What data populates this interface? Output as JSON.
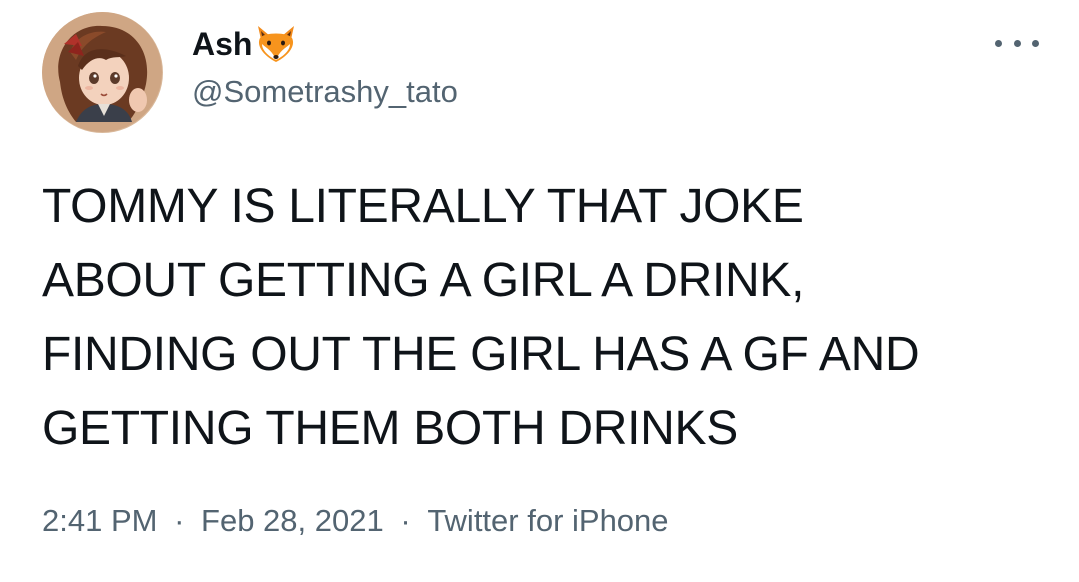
{
  "user": {
    "display_name": "Ash",
    "handle": "@Sometrashy_tato",
    "name_emoji": "fox-icon",
    "avatar": "avatar-illustration"
  },
  "tweet": {
    "lines": [
      "TOMMY IS LITERALLY THAT JOKE",
      "ABOUT GETTING A GIRL A DRINK,",
      "FINDING OUT THE GIRL HAS A GF AND",
      "GETTING THEM BOTH DRINKS"
    ],
    "time": "2:41 PM",
    "separator": "·",
    "date": "Feb 28, 2021",
    "source": "Twitter for iPhone"
  },
  "colors": {
    "text": "#0f1419",
    "secondary": "#536471",
    "background": "#ffffff"
  },
  "icons": {
    "more": "more-options-icon"
  }
}
